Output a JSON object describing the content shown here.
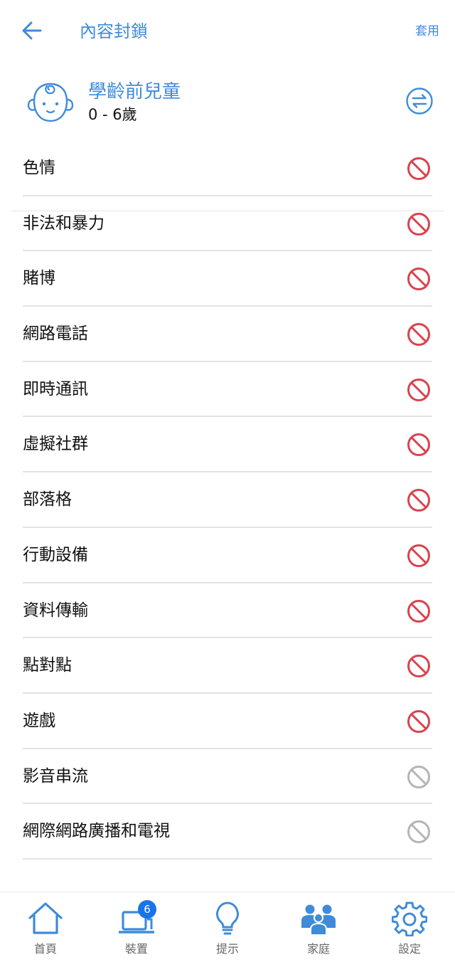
{
  "header": {
    "title": "內容封鎖",
    "apply_label": "套用"
  },
  "profile": {
    "name": "學齡前兒童",
    "age_range": "0 - 6歲"
  },
  "categories": [
    {
      "label": "色情",
      "blocked": true
    },
    {
      "label": "非法和暴力",
      "blocked": true
    },
    {
      "label": "賭博",
      "blocked": true
    },
    {
      "label": "網路電話",
      "blocked": true
    },
    {
      "label": "即時通訊",
      "blocked": true
    },
    {
      "label": "虛擬社群",
      "blocked": true
    },
    {
      "label": "部落格",
      "blocked": true
    },
    {
      "label": "行動設備",
      "blocked": true
    },
    {
      "label": "資料傳輸",
      "blocked": true
    },
    {
      "label": "點對點",
      "blocked": true
    },
    {
      "label": "遊戲",
      "blocked": true
    },
    {
      "label": "影音串流",
      "blocked": false
    },
    {
      "label": "網際網路廣播和電視",
      "blocked": false
    }
  ],
  "tabs": [
    {
      "label": "首頁",
      "icon": "home-icon"
    },
    {
      "label": "裝置",
      "icon": "laptop-icon",
      "badge": "6"
    },
    {
      "label": "提示",
      "icon": "lightbulb-icon"
    },
    {
      "label": "家庭",
      "icon": "family-icon"
    },
    {
      "label": "設定",
      "icon": "gear-icon"
    }
  ],
  "colors": {
    "accent": "#3f8bd9",
    "blocked": "#d9434e",
    "allowed": "#b5b5b5",
    "badge": "#1a73e8"
  }
}
